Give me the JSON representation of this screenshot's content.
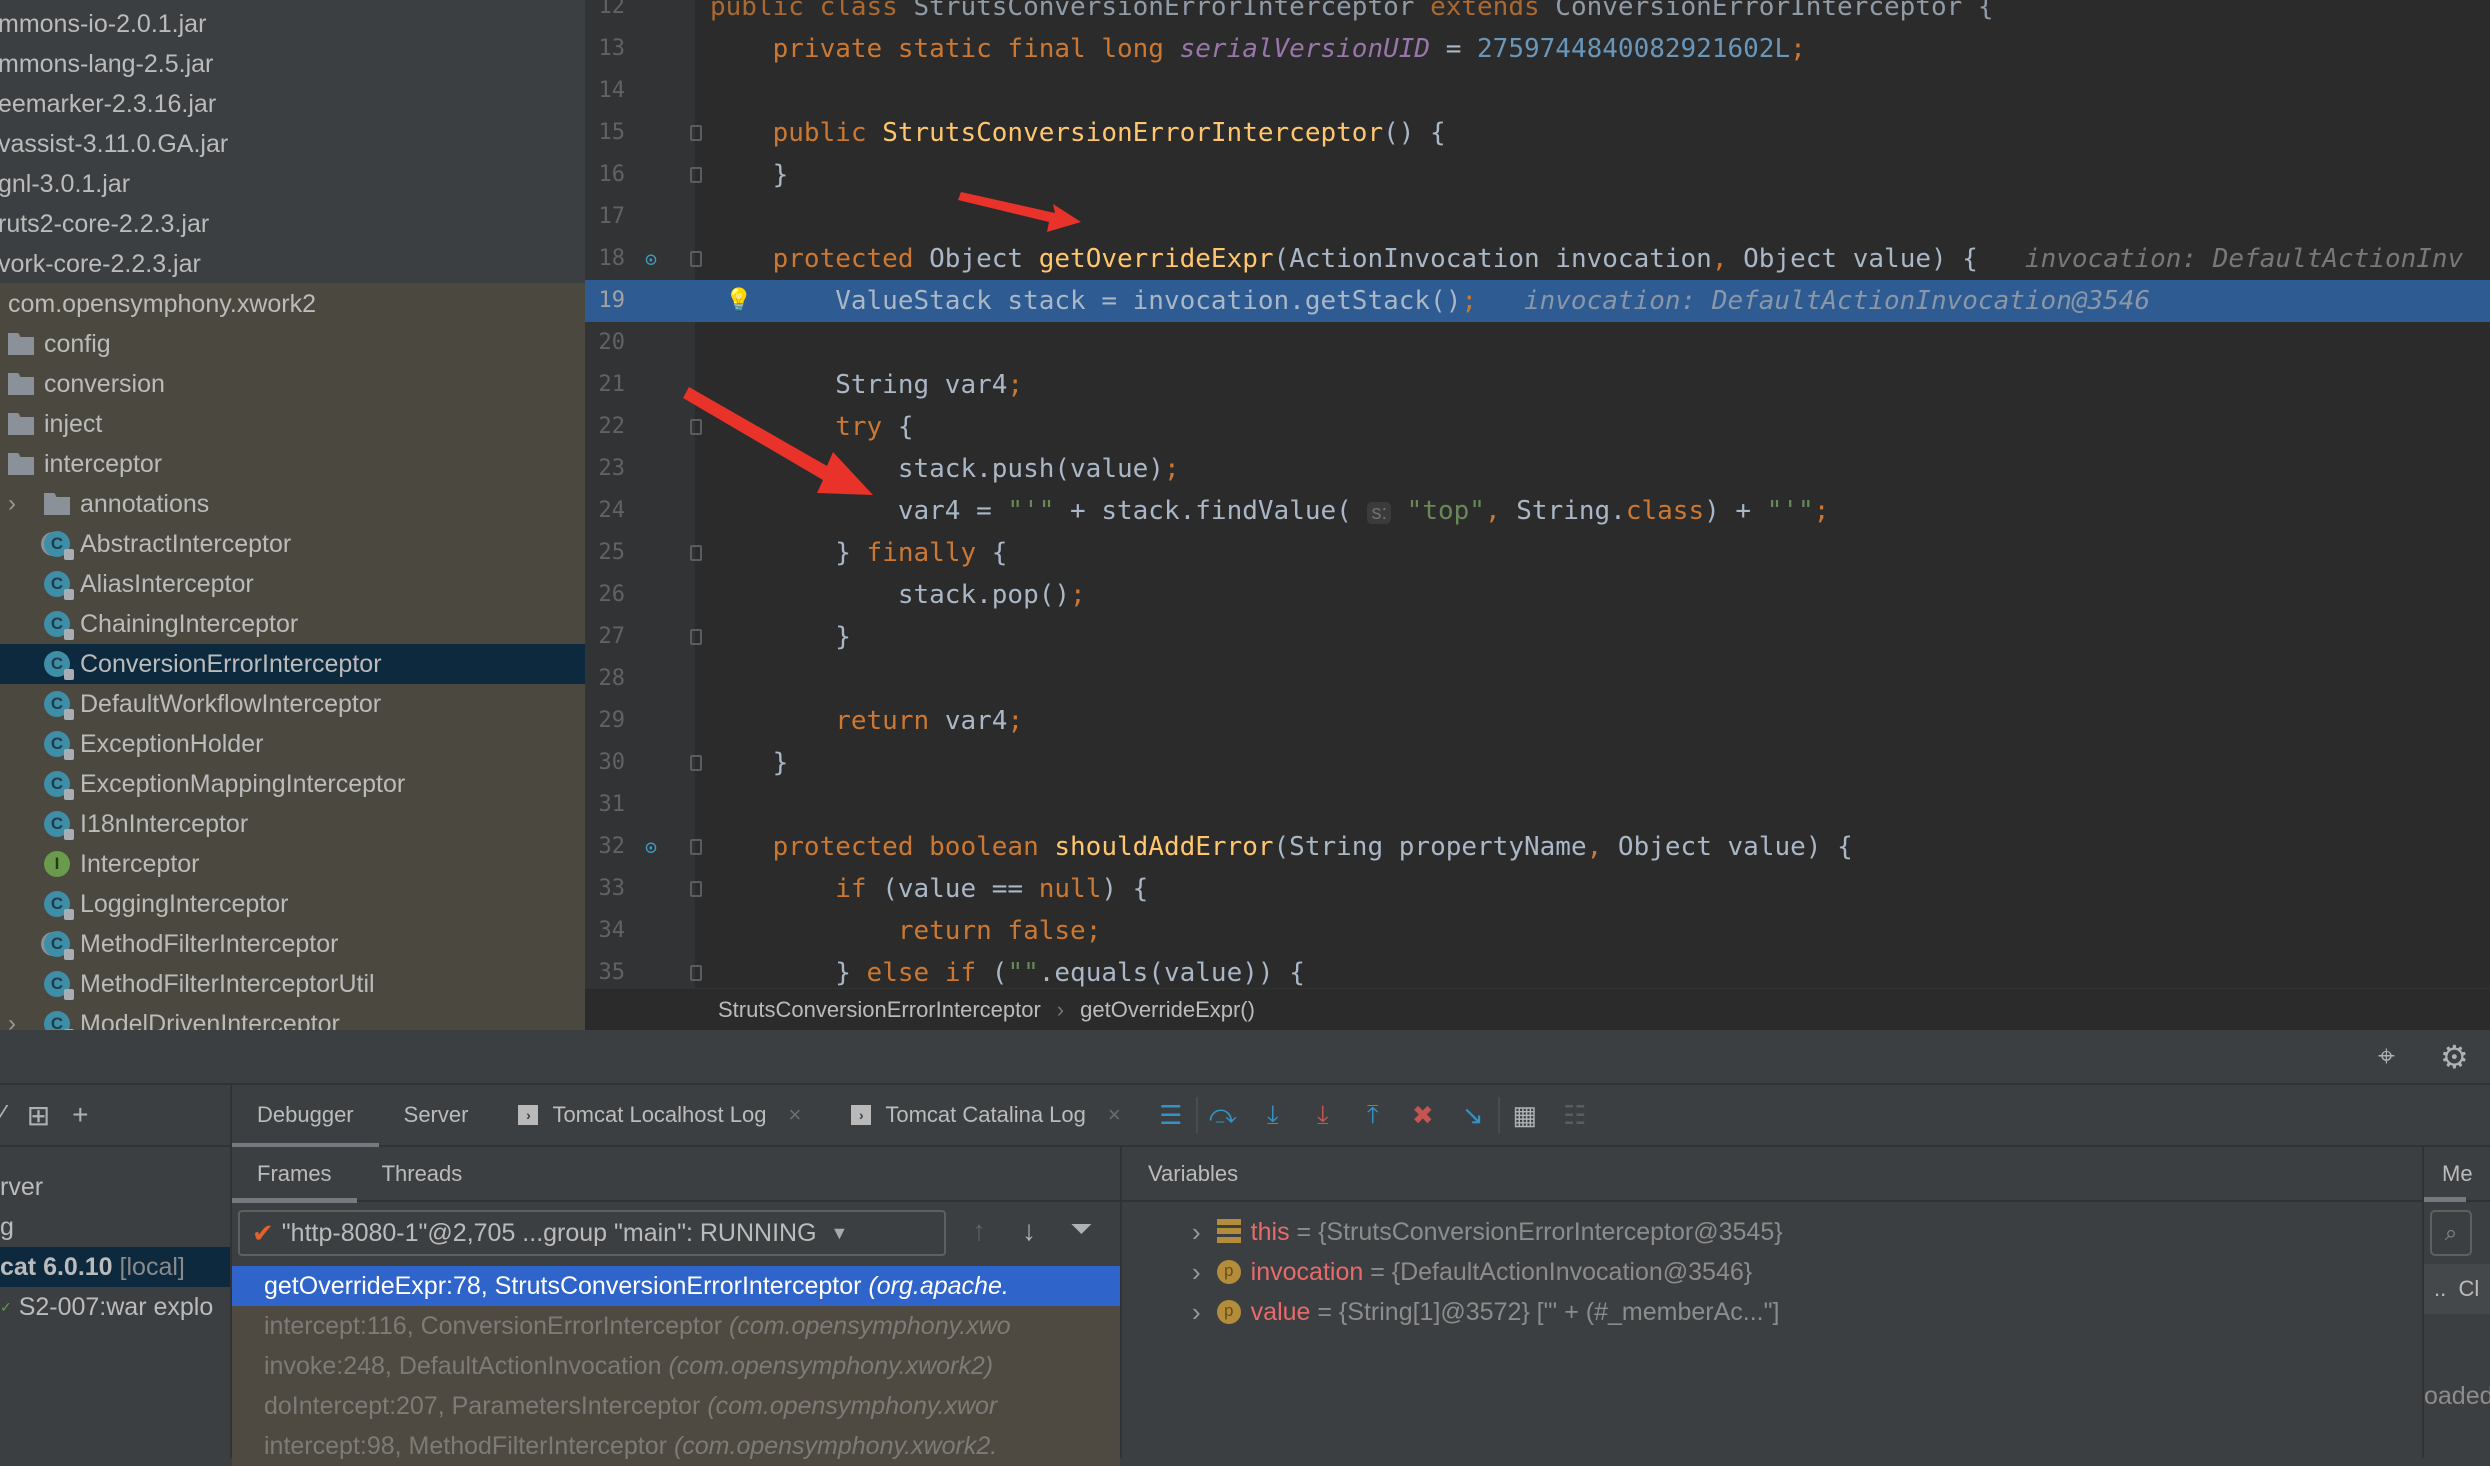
{
  "project_tree": {
    "jars": [
      "mmons-io-2.0.1.jar",
      "mmons-lang-2.5.jar",
      "eemarker-2.3.16.jar",
      "vassist-3.11.0.GA.jar",
      "gnl-3.0.1.jar",
      "ruts2-core-2.2.3.jar",
      "vork-core-2.2.3.jar"
    ],
    "package": "com.opensymphony.xwork2",
    "folders": [
      "config",
      "conversion",
      "inject",
      "interceptor"
    ],
    "subfolder": "annotations",
    "classes": [
      {
        "name": "AbstractInterceptor",
        "icon": "abstract-class-icon"
      },
      {
        "name": "AliasInterceptor",
        "icon": "class-icon"
      },
      {
        "name": "ChainingInterceptor",
        "icon": "class-icon"
      },
      {
        "name": "ConversionErrorInterceptor",
        "icon": "class-icon",
        "selected": true
      },
      {
        "name": "DefaultWorkflowInterceptor",
        "icon": "class-icon"
      },
      {
        "name": "ExceptionHolder",
        "icon": "class-icon"
      },
      {
        "name": "ExceptionMappingInterceptor",
        "icon": "class-icon"
      },
      {
        "name": "I18nInterceptor",
        "icon": "class-icon"
      },
      {
        "name": "Interceptor",
        "icon": "interface-icon"
      },
      {
        "name": "LoggingInterceptor",
        "icon": "class-icon"
      },
      {
        "name": "MethodFilterInterceptor",
        "icon": "abstract-class-icon"
      },
      {
        "name": "MethodFilterInterceptorUtil",
        "icon": "class-icon"
      },
      {
        "name": "ModelDrivenInterceptor",
        "icon": "class-icon"
      }
    ]
  },
  "editor": {
    "current_line": 19,
    "lines": [
      {
        "n": "12",
        "t": [
          [
            "public class ",
            "kw"
          ],
          [
            "StrutsConversionErrorInterceptor ",
            "id"
          ],
          [
            "extends ",
            "kw"
          ],
          [
            "ConversionErrorInterceptor {",
            "id"
          ]
        ]
      },
      {
        "n": "13",
        "t": [
          [
            "    private static final long ",
            "kw"
          ],
          [
            "serialVersionUID",
            "fld"
          ],
          [
            " = ",
            "id"
          ],
          [
            "2759744840082921602L",
            "num"
          ],
          [
            ";",
            "kw"
          ]
        ]
      },
      {
        "n": "14",
        "t": []
      },
      {
        "n": "15",
        "t": [
          [
            "    public ",
            "kw"
          ],
          [
            "StrutsConversionErrorInterceptor",
            "fn"
          ],
          [
            "() {",
            "id"
          ]
        ]
      },
      {
        "n": "16",
        "t": [
          [
            "    }",
            "id"
          ]
        ]
      },
      {
        "n": "17",
        "t": []
      },
      {
        "n": "18",
        "t": [
          [
            "    protected ",
            "kw"
          ],
          [
            "Object ",
            "id"
          ],
          [
            "getOverrideExpr",
            "fn"
          ],
          [
            "(ActionInvocation invocation",
            "id"
          ],
          [
            ", ",
            "kw"
          ],
          [
            "Object value) {",
            "id"
          ],
          [
            "   invocation: DefaultActionInv",
            "hint"
          ]
        ]
      },
      {
        "n": "19",
        "t": [
          [
            "        ValueStack stack = invocation.getStack()",
            "id"
          ],
          [
            ";",
            "kw"
          ],
          [
            "   invocation: DefaultActionInvocation@3546",
            "hintb"
          ]
        ]
      },
      {
        "n": "20",
        "t": []
      },
      {
        "n": "21",
        "t": [
          [
            "        String var4",
            "id"
          ],
          [
            ";",
            "kw"
          ]
        ]
      },
      {
        "n": "22",
        "t": [
          [
            "        try ",
            "kw"
          ],
          [
            "{",
            "id"
          ]
        ]
      },
      {
        "n": "23",
        "t": [
          [
            "            stack.push(value)",
            "id"
          ],
          [
            ";",
            "kw"
          ]
        ]
      },
      {
        "n": "24",
        "t": [
          [
            "            var4 = ",
            "id"
          ],
          [
            "\"'\"",
            "str"
          ],
          [
            " + stack.findValue( ",
            "id"
          ],
          [
            "s:",
            "param"
          ],
          [
            " \"top\"",
            "str"
          ],
          [
            ", ",
            "kw"
          ],
          [
            "String.",
            "id"
          ],
          [
            "class",
            "kw"
          ],
          [
            ") + ",
            "id"
          ],
          [
            "\"'\"",
            "str"
          ],
          [
            ";",
            "kw"
          ]
        ]
      },
      {
        "n": "25",
        "t": [
          [
            "        } ",
            "id"
          ],
          [
            "finally ",
            "kw"
          ],
          [
            "{",
            "id"
          ]
        ]
      },
      {
        "n": "26",
        "t": [
          [
            "            stack.pop()",
            "id"
          ],
          [
            ";",
            "kw"
          ]
        ]
      },
      {
        "n": "27",
        "t": [
          [
            "        }",
            "id"
          ]
        ]
      },
      {
        "n": "28",
        "t": []
      },
      {
        "n": "29",
        "t": [
          [
            "        return ",
            "kw"
          ],
          [
            "var4",
            "id"
          ],
          [
            ";",
            "kw"
          ]
        ]
      },
      {
        "n": "30",
        "t": [
          [
            "    }",
            "id"
          ]
        ]
      },
      {
        "n": "31",
        "t": []
      },
      {
        "n": "32",
        "t": [
          [
            "    protected boolean ",
            "kw"
          ],
          [
            "shouldAddError",
            "fn"
          ],
          [
            "(String propertyName",
            "id"
          ],
          [
            ", ",
            "kw"
          ],
          [
            "Object value) {",
            "id"
          ]
        ]
      },
      {
        "n": "33",
        "t": [
          [
            "        if ",
            "kw"
          ],
          [
            "(value == ",
            "id"
          ],
          [
            "null",
            "kw"
          ],
          [
            ") {",
            "id"
          ]
        ]
      },
      {
        "n": "34",
        "t": [
          [
            "            return false",
            "kw"
          ],
          [
            ";",
            "kw"
          ]
        ]
      },
      {
        "n": "35",
        "t": [
          [
            "        } ",
            "id"
          ],
          [
            "else if ",
            "kw"
          ],
          [
            "(",
            "id"
          ],
          [
            "\"\"",
            "str"
          ],
          [
            ".equals(value)) {",
            "id"
          ]
        ]
      }
    ]
  },
  "breadcrumb": {
    "class": "StrutsConversionErrorInterceptor",
    "method": "getOverrideExpr()",
    "sep": "›"
  },
  "debug_tabs": {
    "tabs": [
      {
        "label": "Debugger",
        "active": true
      },
      {
        "label": "Server"
      },
      {
        "label": "Tomcat Localhost Log",
        "closable": true
      },
      {
        "label": "Tomcat Catalina Log",
        "closable": true
      }
    ],
    "close": "×"
  },
  "services": {
    "items": [
      "rver",
      "g",
      "cat 6.0.10",
      "S2-007:war explo"
    ],
    "local_tag": "[local]"
  },
  "frames": {
    "tab_frames": "Frames",
    "tab_threads": "Threads",
    "thread": "\"http-8080-1\"@2,705 ...group \"main\": RUNNING",
    "rows": [
      {
        "method": "getOverrideExpr:78, StrutsConversionErrorInterceptor",
        "pkg": "(org.apache.",
        "selected": true
      },
      {
        "method": "intercept:116, ConversionErrorInterceptor",
        "pkg": "(com.opensymphony.xwo"
      },
      {
        "method": "invoke:248, DefaultActionInvocation",
        "pkg": "(com.opensymphony.xwork2)"
      },
      {
        "method": "doIntercept:207, ParametersInterceptor",
        "pkg": "(com.opensymphony.xwor"
      },
      {
        "method": "intercept:98, MethodFilterInterceptor",
        "pkg": "(com.opensymphony.xwork2."
      }
    ]
  },
  "variables": {
    "title": "Variables",
    "rows": [
      {
        "name": "this",
        "value": "= {StrutsConversionErrorInterceptor@3545}",
        "icon": "field-icon"
      },
      {
        "name": "invocation",
        "value": "= {DefaultActionInvocation@3546}",
        "icon": "parameter-icon",
        "badge": "p"
      },
      {
        "name": "value",
        "value": "= {String[1]@3572} [\"' + (#_memberAc...\"]",
        "icon": "parameter-icon",
        "badge": "p"
      }
    ]
  },
  "memory": {
    "title": "Me",
    "col": "Cl",
    "loaded": "oaded",
    "dots": ".."
  },
  "colors": {
    "keyword": "#cc7832",
    "function": "#ffc66d",
    "string": "#6a8759",
    "number": "#6897bb",
    "selection": "#2f65ca",
    "execution_line": "#2d5b92",
    "annotation_arrow": "#e8322a"
  }
}
